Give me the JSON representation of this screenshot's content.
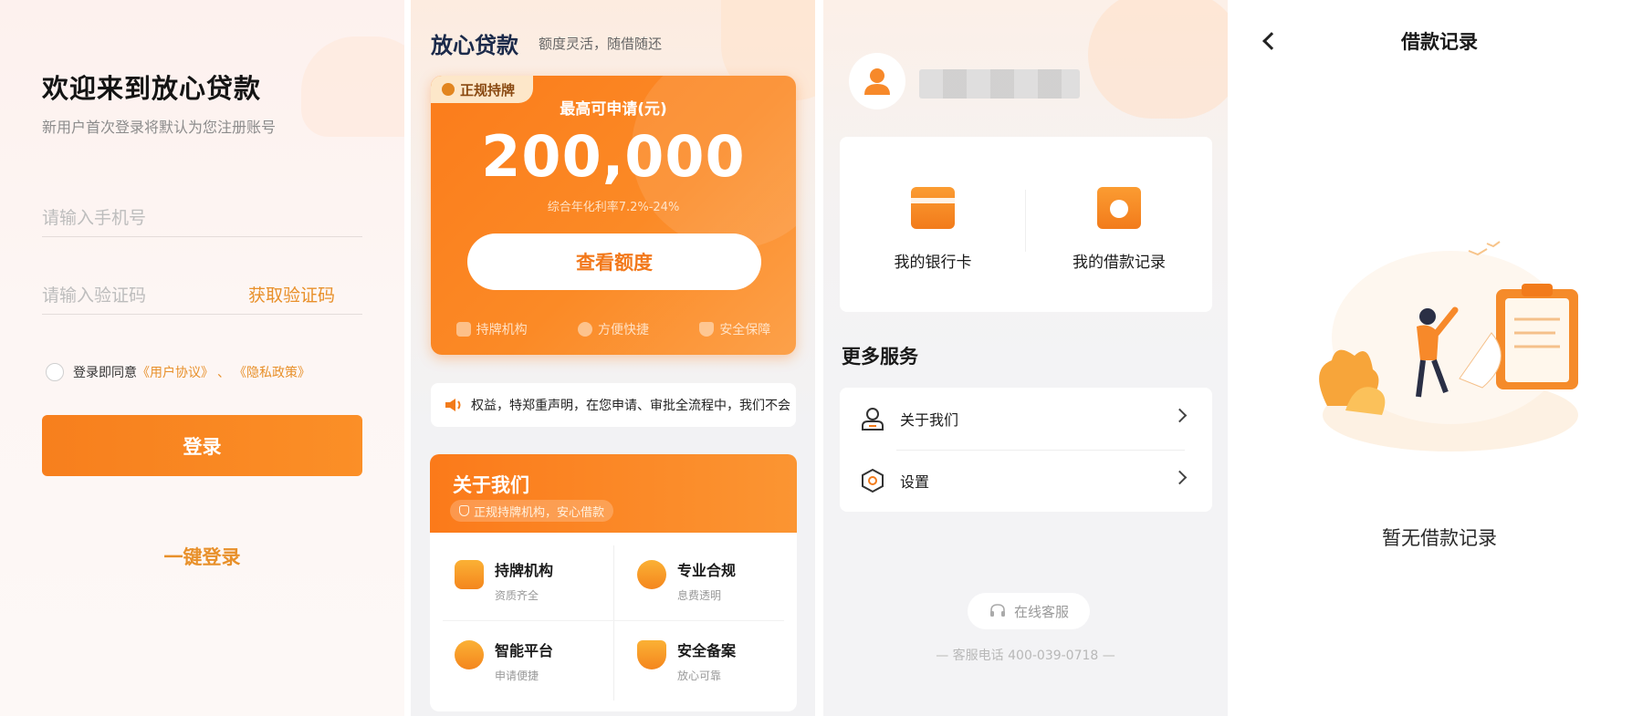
{
  "login": {
    "title": "欢迎来到放心贷款",
    "subtitle": "新用户首次登录将默认为您注册账号",
    "phone_placeholder": "请输入手机号",
    "code_placeholder": "请输入验证码",
    "get_code": "获取验证码",
    "agree_prefix": "登录即同意",
    "user_agreement": "《用户协议》",
    "agree_sep": "、",
    "privacy_policy": "《隐私政策》",
    "login_button": "登录",
    "one_click_login": "一键登录"
  },
  "home": {
    "brand": "放心贷款",
    "brand_sub": "额度灵活，随借随还",
    "badge": "正规持牌",
    "max_label": "最高可申请(元)",
    "amount": "200,000",
    "rate": "综合年化利率7.2%-24%",
    "check_button": "查看额度",
    "features": [
      "持牌机构",
      "方便快捷",
      "安全保障"
    ],
    "notice": "权益，特郑重声明，在您申请、审批全流程中，我们不会",
    "about": {
      "title": "关于我们",
      "tag": "正规持牌机构，安心借款",
      "items": [
        {
          "title": "持牌机构",
          "sub": "资质齐全"
        },
        {
          "title": "专业合规",
          "sub": "息费透明"
        },
        {
          "title": "智能平台",
          "sub": "申请便捷"
        },
        {
          "title": "安全备案",
          "sub": "放心可靠"
        }
      ]
    }
  },
  "mine": {
    "bank_card": "我的银行卡",
    "loan_records": "我的借款记录",
    "more_services": "更多服务",
    "about_us": "关于我们",
    "settings": "设置",
    "online_service": "在线客服",
    "phone": "— 客服电话 400-039-0718 —"
  },
  "records": {
    "title": "借款记录",
    "empty": "暂无借款记录"
  },
  "colors": {
    "accent": "#f77f1d",
    "accent_text": "#e8902a"
  }
}
